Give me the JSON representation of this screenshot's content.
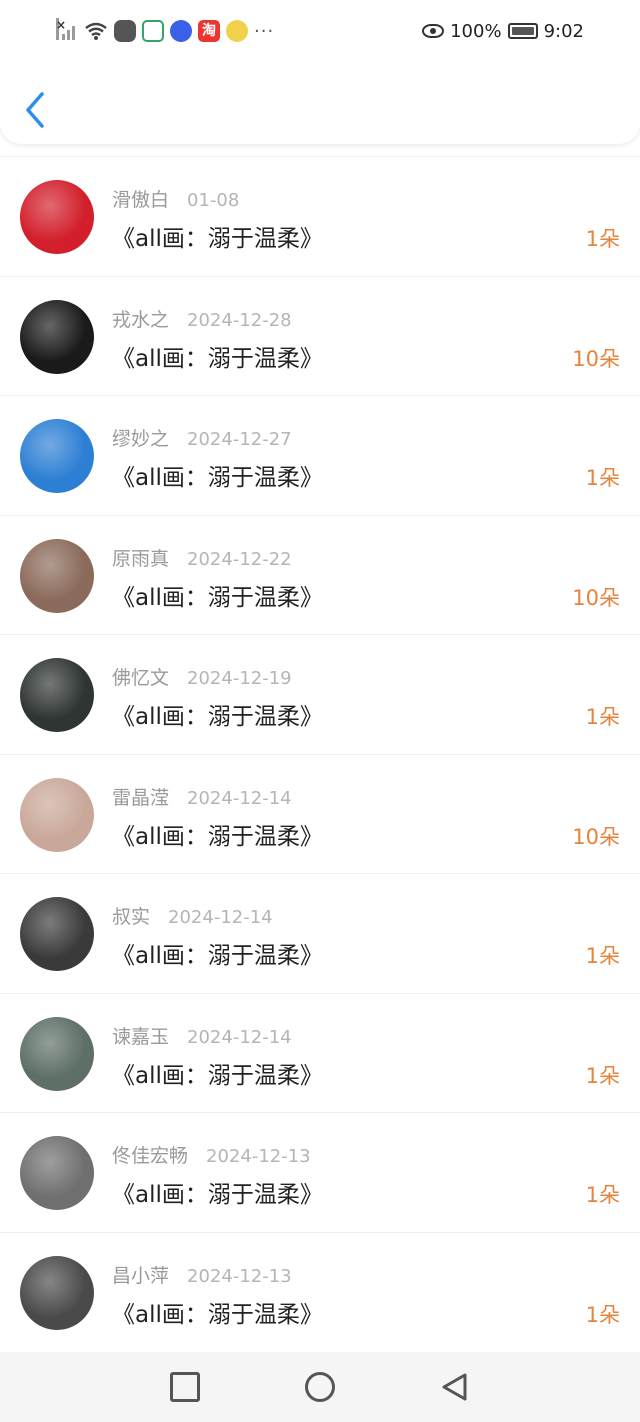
{
  "status_bar": {
    "battery_percent": "100%",
    "time": "9:02",
    "icons": [
      "signal-off-icon",
      "wifi-icon",
      "game-icon",
      "home-app-icon",
      "music-icon",
      "taobao-icon",
      "bird-app-icon",
      "more-icon",
      "eye-icon",
      "battery-icon"
    ],
    "taobao_glyph": "淘",
    "more_glyph": "···"
  },
  "header": {
    "back_icon": "back-chevron-icon"
  },
  "list": {
    "items": [
      {
        "name": "滑傲白",
        "date": "01-08",
        "title": "《all画：溺于温柔》",
        "amount": "1朵",
        "avatar_color": "#d21f2b"
      },
      {
        "name": "戎水之",
        "date": "2024-12-28",
        "title": "《all画：溺于温柔》",
        "amount": "10朵",
        "avatar_color": "#1a1a1a"
      },
      {
        "name": "缪妙之",
        "date": "2024-12-27",
        "title": "《all画：溺于温柔》",
        "amount": "1朵",
        "avatar_color": "#2d7fd4"
      },
      {
        "name": "原雨真",
        "date": "2024-12-22",
        "title": "《all画：溺于温柔》",
        "amount": "10朵",
        "avatar_color": "#8a6a5a"
      },
      {
        "name": "佛忆文",
        "date": "2024-12-19",
        "title": "《all画：溺于温柔》",
        "amount": "1朵",
        "avatar_color": "#2f3533"
      },
      {
        "name": "雷晶滢",
        "date": "2024-12-14",
        "title": "《all画：溺于温柔》",
        "amount": "10朵",
        "avatar_color": "#c9a89a"
      },
      {
        "name": "叔实",
        "date": "2024-12-14",
        "title": "《all画：溺于温柔》",
        "amount": "1朵",
        "avatar_color": "#3a3a3a"
      },
      {
        "name": "谏嘉玉",
        "date": "2024-12-14",
        "title": "《all画：溺于温柔》",
        "amount": "1朵",
        "avatar_color": "#5d6f66"
      },
      {
        "name": "佟佳宏畅",
        "date": "2024-12-13",
        "title": "《all画：溺于温柔》",
        "amount": "1朵",
        "avatar_color": "#6f6f6f"
      },
      {
        "name": "昌小萍",
        "date": "2024-12-13",
        "title": "《all画：溺于温柔》",
        "amount": "1朵",
        "avatar_color": "#4a4a4a"
      }
    ]
  },
  "nav_bar": {
    "buttons": [
      "recent-apps-icon",
      "home-icon",
      "back-icon"
    ]
  },
  "colors": {
    "accent_blue": "#2a8ef0",
    "amount_orange": "#e8833a",
    "name_gray": "#9a9a9a"
  }
}
